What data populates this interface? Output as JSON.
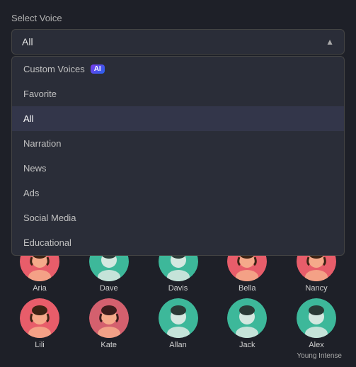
{
  "header": {
    "label": "Select Voice"
  },
  "dropdown": {
    "selected": "All",
    "chevron": "▲",
    "items": [
      {
        "id": "custom-voices",
        "label": "Custom Voices",
        "badge": "AI",
        "active": false
      },
      {
        "id": "favorite",
        "label": "Favorite",
        "badge": null,
        "active": false
      },
      {
        "id": "all",
        "label": "All",
        "badge": null,
        "active": true
      },
      {
        "id": "narration",
        "label": "Narration",
        "badge": null,
        "active": false
      },
      {
        "id": "news",
        "label": "News",
        "badge": null,
        "active": false
      },
      {
        "id": "ads",
        "label": "Ads",
        "badge": null,
        "active": false
      },
      {
        "id": "social-media",
        "label": "Social Media",
        "badge": null,
        "active": false
      },
      {
        "id": "educational",
        "label": "Educational",
        "badge": null,
        "active": false
      }
    ]
  },
  "voices_row1": [
    {
      "name": "Aria",
      "scheme": "coral"
    },
    {
      "name": "Dave",
      "scheme": "teal"
    },
    {
      "name": "Davis",
      "scheme": "teal"
    },
    {
      "name": "Bella",
      "scheme": "coral"
    },
    {
      "name": "Nancy",
      "scheme": "coral"
    }
  ],
  "voices_row2": [
    {
      "name": "Lili",
      "scheme": "coral"
    },
    {
      "name": "Kate",
      "scheme": "pink"
    },
    {
      "name": "Allan",
      "scheme": "teal"
    },
    {
      "name": "Jack",
      "scheme": "teal"
    },
    {
      "name": "Alex",
      "scheme": "teal"
    }
  ],
  "tag": "Young Intense"
}
